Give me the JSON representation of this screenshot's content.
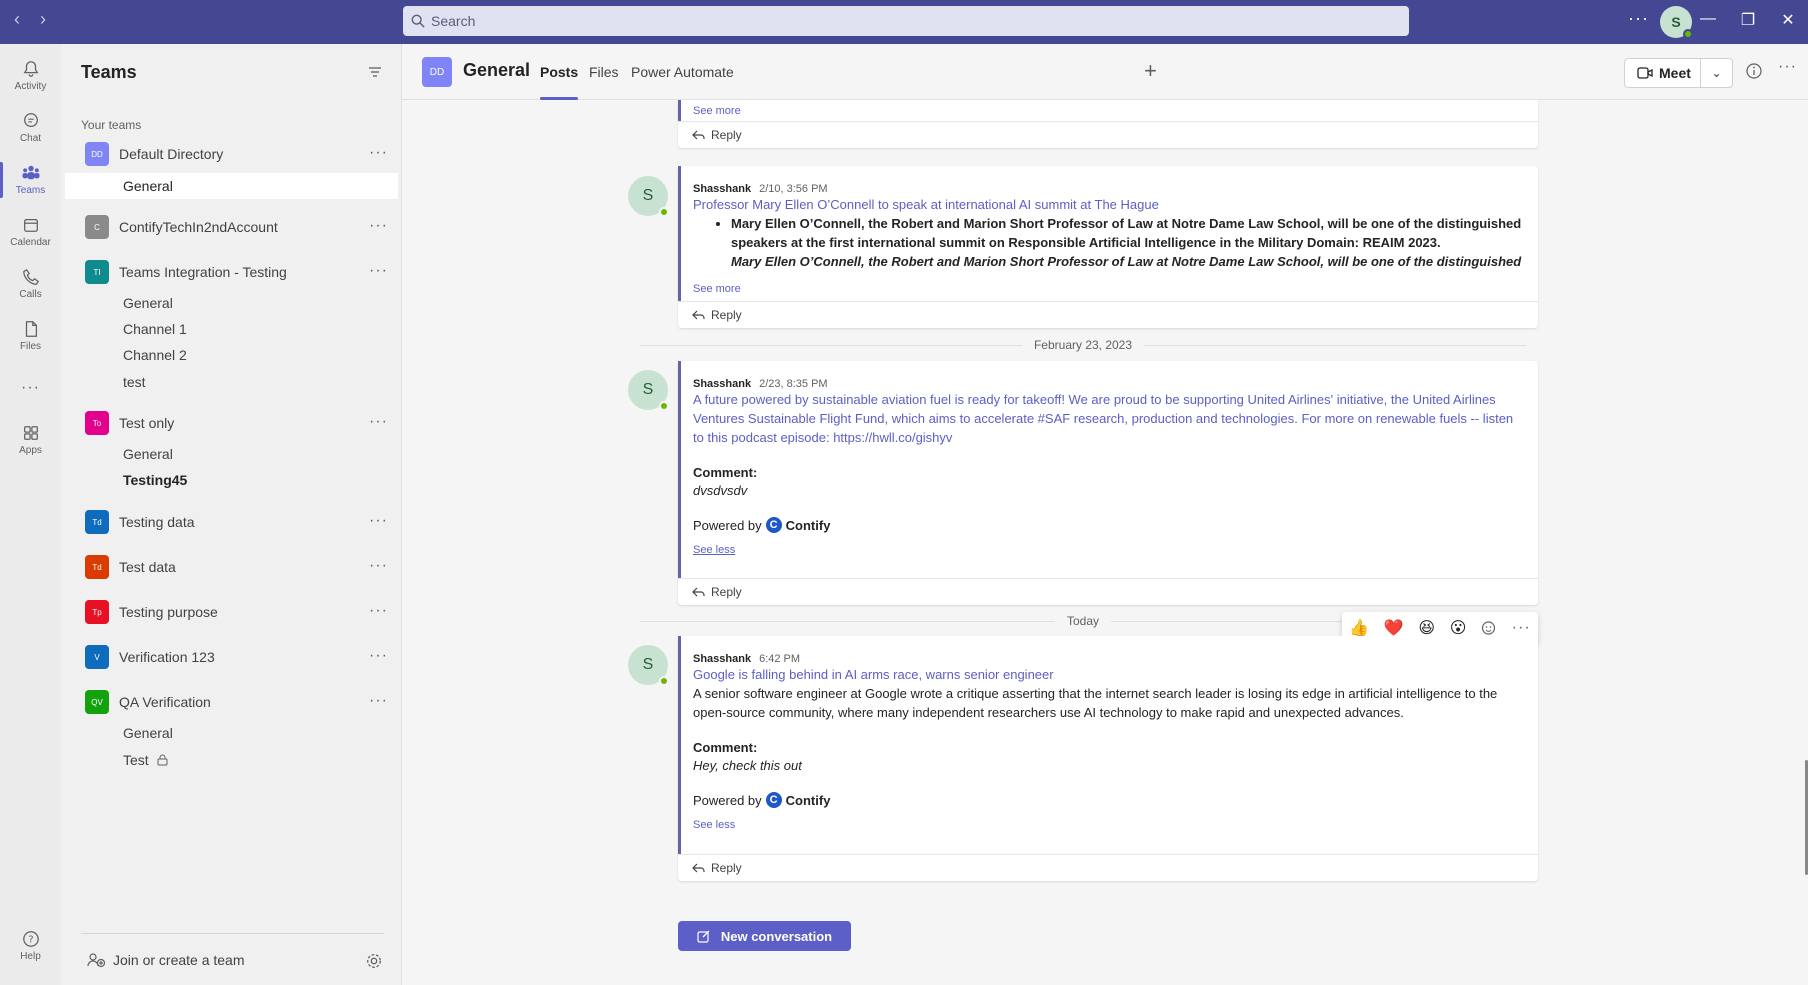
{
  "titlebar": {
    "search_placeholder": "Search",
    "avatar_initial": "S"
  },
  "rail": [
    {
      "label": "Activity",
      "icon": "bell-icon"
    },
    {
      "label": "Chat",
      "icon": "chat-icon"
    },
    {
      "label": "Teams",
      "icon": "teams-icon",
      "active": true
    },
    {
      "label": "Calendar",
      "icon": "calendar-icon"
    },
    {
      "label": "Calls",
      "icon": "phone-icon"
    },
    {
      "label": "Files",
      "icon": "file-icon"
    },
    {
      "label": "Apps",
      "icon": "apps-icon"
    },
    {
      "label": "Help",
      "icon": "help-icon"
    }
  ],
  "teams_panel": {
    "title": "Teams",
    "section_label": "Your teams",
    "teams": [
      {
        "initials": "DD",
        "name": "Default Directory",
        "color": "#7f85f5"
      },
      {
        "initials": "C",
        "name": "ContifyTechIn2ndAccount",
        "color": "#8a8a8a"
      },
      {
        "initials": "TI",
        "name": "Teams Integration - Testing",
        "color": "#0f8b8d"
      },
      {
        "initials": "To",
        "name": "Test only",
        "color": "#e3008c"
      },
      {
        "initials": "Td",
        "name": "Testing data",
        "color": "#0f6cbd"
      },
      {
        "initials": "Td",
        "name": "Test data",
        "color": "#da3b01"
      },
      {
        "initials": "Tp",
        "name": "Testing purpose",
        "color": "#e81123"
      },
      {
        "initials": "V",
        "name": "Verification 123",
        "color": "#0f6cbd"
      },
      {
        "initials": "QV",
        "name": "QA Verification",
        "color": "#13a10e"
      }
    ],
    "channels": {
      "default_directory": [
        "General"
      ],
      "teams_integration": [
        "General",
        "Channel 1",
        "Channel 2",
        "test"
      ],
      "test_only": [
        "General",
        "Testing45"
      ],
      "qa_verification": [
        "General",
        "Test"
      ]
    },
    "join_label": "Join or create a team"
  },
  "header": {
    "avatar_initials": "DD",
    "channel_title": "General",
    "tabs": [
      "Posts",
      "Files",
      "Power Automate"
    ],
    "meet_label": "Meet"
  },
  "messages": [
    {
      "see_more": "See more",
      "reply": "Reply"
    },
    {
      "author": "Shasshank",
      "time": "2/10, 3:56 PM",
      "headline": "Professor Mary Ellen O’Connell to speak at international AI summit at The Hague",
      "bullet_1": "Mary Ellen O’Connell, the Robert and Marion Short Professor of Law at Notre Dame Law School, will be one of the distinguished speakers at the first international summit on Responsible Artificial Intelligence in the Military Domain: REAIM 2023.",
      "bullet_2": "Mary Ellen O’Connell, the Robert and Marion Short Professor of Law at Notre Dame Law School, will be one of the distinguished speakers at the first international summit on Responsible Artificial Intelligence in the Military Domain: REAIM 2023.",
      "see_more": "See more",
      "reply": "Reply"
    },
    {
      "author": "Shasshank",
      "time": "2/23, 8:35 PM",
      "headline": "A future powered by sustainable aviation fuel is ready for takeoff! We are proud to be supporting United Airlines' initiative, the United Airlines Ventures Sustainable Flight Fund, which aims to accelerate #SAF research, production and technologies. For more on renewable fuels -- listen to this podcast episode: https://hwll.co/gishyv",
      "comment_label": "Comment:",
      "comment": "dvsdvsdv",
      "powered_by": "Powered by",
      "brand": "Contify",
      "see_less": "See less",
      "reply": "Reply"
    },
    {
      "author": "Shasshank",
      "time": "6:42 PM",
      "headline": "Google is falling behind in AI arms race, warns senior engineer",
      "body": "A senior software engineer at Google wrote a critique asserting that the internet search leader is losing its edge in artificial intelligence to the open-source community, where many independent researchers use AI technology to make rapid and unexpected advances.",
      "comment_label": "Comment:",
      "comment": "Hey, check this out",
      "powered_by": "Powered by",
      "brand": "Contify",
      "see_less": "See less",
      "reply": "Reply"
    }
  ],
  "date_separators": [
    "February 23, 2023",
    "Today"
  ],
  "author_initial": "S",
  "reactions": [
    "👍",
    "❤️",
    "😆",
    "😮"
  ],
  "new_conversation": "New conversation"
}
